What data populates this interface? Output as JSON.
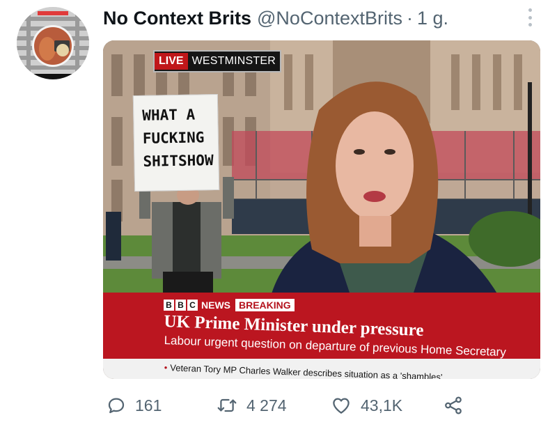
{
  "tweet": {
    "display_name": "No Context Brits",
    "handle": "@NoContextBrits",
    "separator": "·",
    "time": "1 g.",
    "more_icon": "more-vertical-icon"
  },
  "media": {
    "live_label": "LIVE",
    "location_label": "WESTMINSTER",
    "sign_lines": [
      "WHAT A",
      "FUCKING",
      "SHITSHOW"
    ],
    "bbc_letters": [
      "B",
      "B",
      "C"
    ],
    "news_label": "NEWS",
    "breaking_label": "BREAKING",
    "headline": "UK Prime Minister under pressure",
    "subheadline": "Labour urgent question on departure of previous Home Secretary",
    "ticker_bullet": "•",
    "ticker": "Veteran Tory MP Charles Walker describes situation as a 'shambles'"
  },
  "actions": {
    "reply_count": "161",
    "retweet_count": "4 274",
    "like_count": "43,1K",
    "reply_icon": "reply-bubble-icon",
    "retweet_icon": "retweet-icon",
    "like_icon": "heart-icon",
    "share_icon": "share-icon"
  },
  "colors": {
    "bbc_red": "#bb1620",
    "text_secondary": "#536471"
  }
}
